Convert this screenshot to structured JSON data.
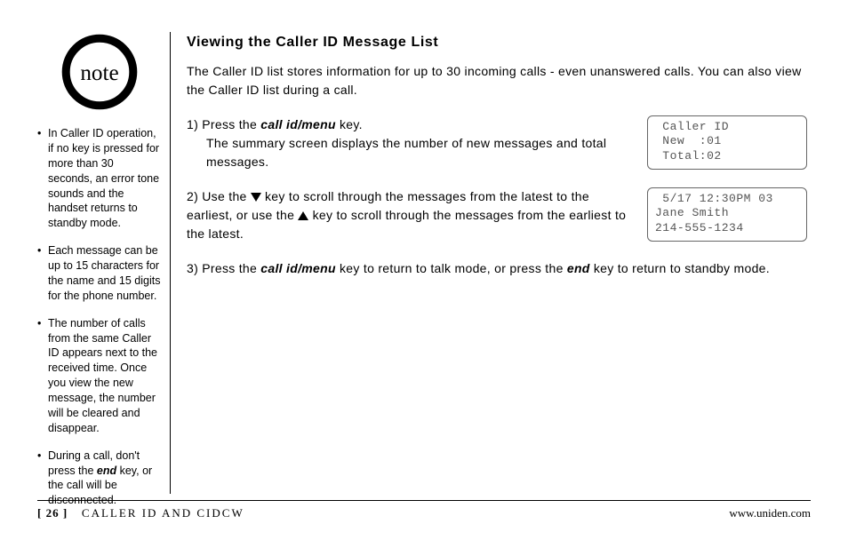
{
  "sidebar": {
    "note_label": "note",
    "items": [
      "In Caller ID operation, if no key is pressed for more than 30 seconds, an error tone sounds and the handset returns to standby mode.",
      "Each message can be up to 15 characters for the name and 15 digits for the phone number.",
      "The number of calls from the same Caller ID appears next to the received time. Once you view the new message, the number will be cleared and disappear."
    ],
    "item4_pre": "During a call, don't press the ",
    "item4_key": "end",
    "item4_post": " key, or the call will be disconnected."
  },
  "main": {
    "heading": "Viewing the Caller ID Message List",
    "intro": "The Caller ID list stores information for up to 30 incoming calls - even unanswered calls. You can also view the Caller ID list during a call.",
    "step1": {
      "num": "1)",
      "pre": "Press the ",
      "key": "call id/menu",
      "post": " key.",
      "line2": "The summary screen displays the number of new messages and total messages."
    },
    "step2": {
      "num": "2)",
      "pre": "Use the ",
      "mid": " key to scroll through the messages from the latest to the earliest, or use the ",
      "post": " key to scroll through the messages from the earliest to the latest."
    },
    "step3": {
      "num": "3)",
      "pre": "Press the ",
      "key1": "call id/menu",
      "mid": " key to return to talk mode, or press the ",
      "key2": "end",
      "post": " key to return to standby mode."
    }
  },
  "lcd": {
    "screen1_l1": " Caller ID",
    "screen1_l2": " New  :01",
    "screen1_l3": " Total:02",
    "screen2_l1": " 5/17 12:30PM 03",
    "screen2_l2": "Jane Smith",
    "screen2_l3": "214-555-1234"
  },
  "footer": {
    "page": "[ 26 ]",
    "section": "CALLER ID AND CIDCW",
    "url": "www.uniden.com"
  }
}
